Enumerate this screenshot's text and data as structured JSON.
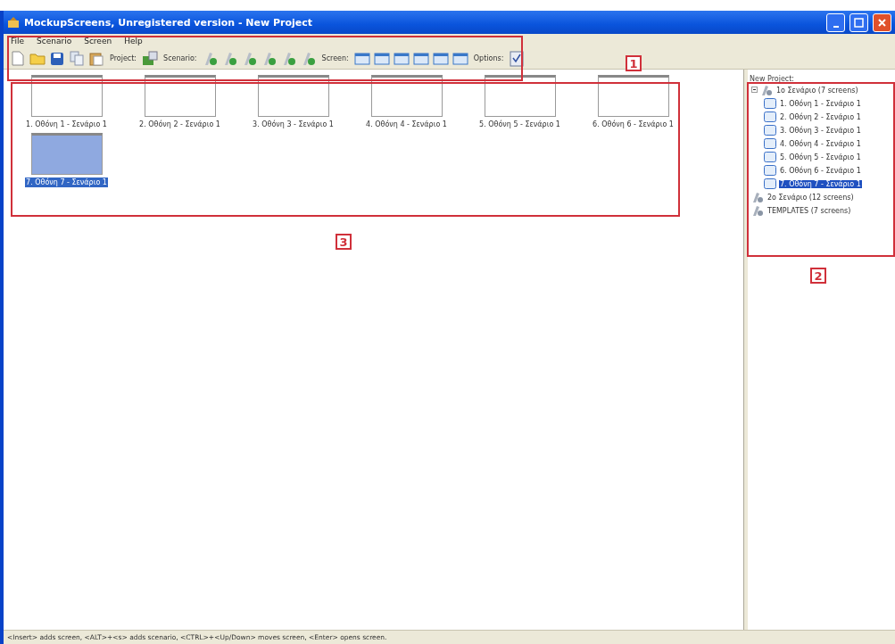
{
  "window": {
    "title": "MockupScreens, Unregistered version - New Project"
  },
  "menu": [
    {
      "label": "File"
    },
    {
      "label": "Scenario"
    },
    {
      "label": "Screen"
    },
    {
      "label": "Help"
    }
  ],
  "toolbar": {
    "groups": [
      {
        "label": "Project:"
      },
      {
        "label": "Scenario:"
      },
      {
        "label": "Screen:"
      },
      {
        "label": "Options:"
      }
    ]
  },
  "thumbnails": [
    {
      "caption": "1. Οθόνη 1 - Σενάριο 1",
      "selected": false
    },
    {
      "caption": "2. Οθόνη 2 - Σενάριο 1",
      "selected": false
    },
    {
      "caption": "3. Οθόνη 3 - Σενάριο 1",
      "selected": false
    },
    {
      "caption": "4. Οθόνη 4 - Σενάριο 1",
      "selected": false
    },
    {
      "caption": "5. Οθόνη 5 - Σενάριο 1",
      "selected": false
    },
    {
      "caption": "6. Οθόνη 6 - Σενάριο 1",
      "selected": false
    },
    {
      "caption": "7. Οθόνη 7 - Σενάριο 1",
      "selected": true
    }
  ],
  "tree": {
    "root": "New Project:",
    "children": [
      {
        "label": "1ο Σενάριο (7 screens)",
        "kind": "scenario",
        "expanded": true,
        "selected": false,
        "children": [
          {
            "label": "1. Οθόνη 1 - Σενάριο 1",
            "kind": "screen",
            "selected": false
          },
          {
            "label": "2. Οθόνη 2 - Σενάριο 1",
            "kind": "screen",
            "selected": false
          },
          {
            "label": "3. Οθόνη 3 - Σενάριο 1",
            "kind": "screen",
            "selected": false
          },
          {
            "label": "4. Οθόνη 4 - Σενάριο 1",
            "kind": "screen",
            "selected": false
          },
          {
            "label": "5. Οθόνη 5 - Σενάριο 1",
            "kind": "screen",
            "selected": false
          },
          {
            "label": "6. Οθόνη 6 - Σενάριο 1",
            "kind": "screen",
            "selected": false
          },
          {
            "label": "7. Οθόνη 7 - Σενάριο 1",
            "kind": "screen",
            "selected": true
          }
        ]
      },
      {
        "label": "2ο Σενάριο (12 screens)",
        "kind": "scenario",
        "selected": false
      },
      {
        "label": "TEMPLATES (7 screens)",
        "kind": "scenario",
        "selected": false
      }
    ]
  },
  "annotations": [
    {
      "label": "1"
    },
    {
      "label": "2"
    },
    {
      "label": "3"
    }
  ],
  "status_bar": "<Insert> adds screen, <ALT>+<s> adds scenario, <CTRL>+<Up/Down> moves screen, <Enter> opens screen."
}
